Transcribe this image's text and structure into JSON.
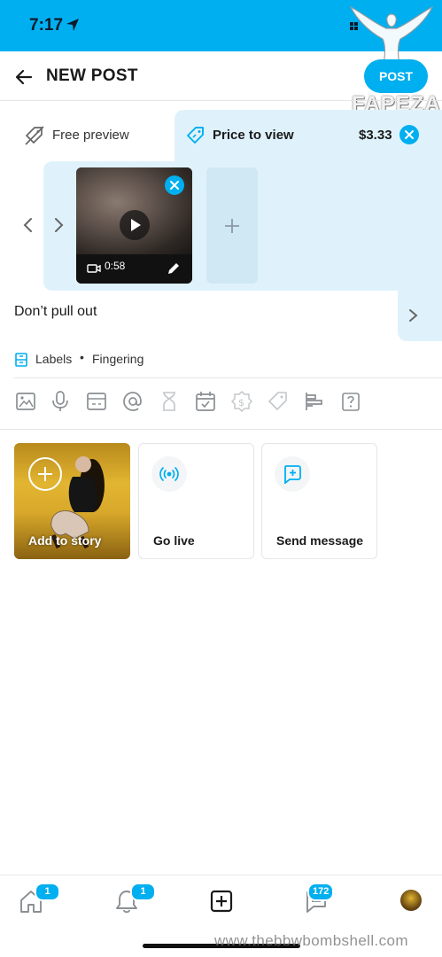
{
  "status": {
    "time": "7:17"
  },
  "watermark": {
    "brand": "FAPEZA",
    "site": "www.thebbwbombshell.com"
  },
  "header": {
    "title": "NEW POST",
    "post_label": "POST"
  },
  "price_tabs": {
    "free_label": "Free preview",
    "paid_label": "Price to view",
    "price": "$3.33"
  },
  "media": {
    "duration": "0:58"
  },
  "caption": {
    "text": "Don’t pull out"
  },
  "labels": {
    "title": "Labels",
    "separator": "•",
    "value": "Fingering"
  },
  "toolbar": {
    "icons": [
      "image-icon",
      "microphone-icon",
      "vault-icon",
      "mention-icon",
      "hourglass-icon",
      "schedule-icon",
      "fundraise-icon",
      "price-tag-icon",
      "poll-icon",
      "quiz-icon"
    ]
  },
  "actions": {
    "story_label": "Add to story",
    "live_label": "Go live",
    "message_label": "Send message"
  },
  "bottom_nav": {
    "home_badge": "1",
    "notifications_badge": "1",
    "messages_badge": "172"
  },
  "colors": {
    "accent": "#00aff0",
    "panel": "#dff2fc"
  }
}
